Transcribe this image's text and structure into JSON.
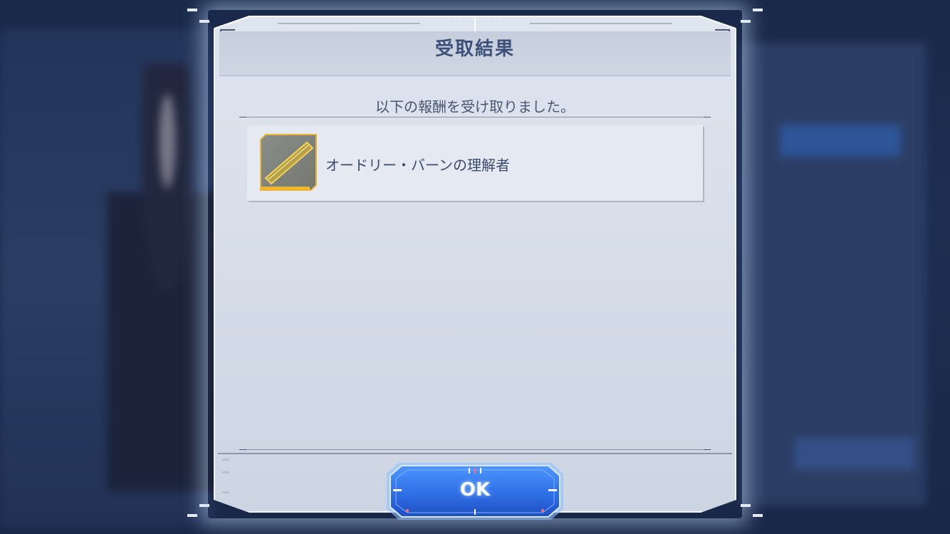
{
  "dialog": {
    "title": "受取結果",
    "message": "以下の報酬を受け取りました。",
    "rewards": [
      {
        "name": "オードリー・バーンの理解者",
        "icon": "gold-title-plate-icon"
      }
    ],
    "ok_label": "OK"
  },
  "colors": {
    "title_text": "#3c5078",
    "button_blue": "#2f6fe6",
    "panel_bg": "#dfe5ef",
    "item_frame_gold": "#e6b53a"
  }
}
